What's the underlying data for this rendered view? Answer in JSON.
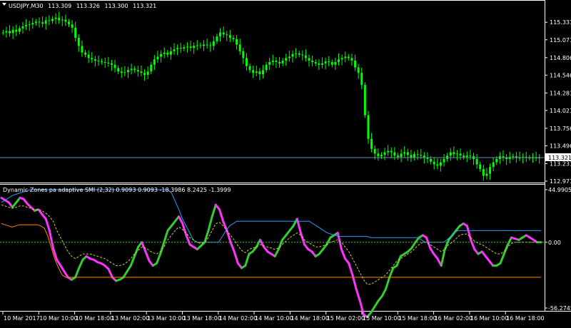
{
  "chart_data": [
    {
      "type": "candlestick",
      "title": "USDJPY,M30",
      "quote": [
        "113.309",
        "113.326",
        "113.300",
        "113.321"
      ],
      "ylim": [
        112.971,
        115.45
      ],
      "ticks": [
        "115.331",
        "115.071",
        "114.806",
        "114.546",
        "114.281",
        "114.021",
        "113.756",
        "113.496",
        "113.231",
        "112.971"
      ],
      "current_price": "113.321",
      "colors": {
        "up": "#00ff00",
        "down": "#00ff00",
        "bg": "#000000",
        "grid": "#ffffff",
        "line": "#6a8fb3",
        "pricebox": "#ffffff"
      },
      "close": [
        115.18,
        115.2,
        115.17,
        115.22,
        115.19,
        115.24,
        115.27,
        115.29,
        115.3,
        115.32,
        115.34,
        115.33,
        115.31,
        115.36,
        115.35,
        115.38,
        115.4,
        115.36,
        115.37,
        115.34,
        115.3,
        115.25,
        115.1,
        114.98,
        114.88,
        114.85,
        114.8,
        114.78,
        114.76,
        114.75,
        114.74,
        114.73,
        114.72,
        114.7,
        114.65,
        114.6,
        114.58,
        114.59,
        114.62,
        114.64,
        114.62,
        114.6,
        114.58,
        114.55,
        114.6,
        114.7,
        114.78,
        114.82,
        114.86,
        114.88,
        114.85,
        114.9,
        114.93,
        114.95,
        114.94,
        114.96,
        114.97,
        114.95,
        114.98,
        114.99,
        114.98,
        115.0,
        114.99,
        114.98,
        115.05,
        115.12,
        115.18,
        115.15,
        115.14,
        115.1,
        115.08,
        115.0,
        114.9,
        114.8,
        114.68,
        114.62,
        114.58,
        114.6,
        114.56,
        114.62,
        114.7,
        114.74,
        114.76,
        114.74,
        114.72,
        114.76,
        114.8,
        114.82,
        114.86,
        114.87,
        114.85,
        114.84,
        114.8,
        114.76,
        114.74,
        114.72,
        114.7,
        114.72,
        114.75,
        114.74,
        114.7,
        114.74,
        114.78,
        114.8,
        114.82,
        114.8,
        114.76,
        114.66,
        114.58,
        114.4,
        113.95,
        113.6,
        113.45,
        113.38,
        113.34,
        113.36,
        113.4,
        113.42,
        113.4,
        113.35,
        113.33,
        113.38,
        113.4,
        113.36,
        113.32,
        113.37,
        113.36,
        113.35,
        113.32,
        113.3,
        113.26,
        113.22,
        113.2,
        113.25,
        113.3,
        113.35,
        113.4,
        113.37,
        113.38,
        113.35,
        113.33,
        113.35,
        113.34,
        113.3,
        113.22,
        113.15,
        113.05,
        113.08,
        113.18,
        113.25,
        113.3,
        113.34,
        113.32,
        113.3,
        113.33,
        113.34,
        113.32,
        113.32,
        113.33,
        113.32,
        113.32,
        113.32,
        113.32,
        113.32
      ]
    },
    {
      "type": "line",
      "title": "Dynamic Zones pa adaptive SMI (2,32) 0.9093 0.9093 -18.3986 8.2425 -1.3999",
      "ylim": [
        -56.2745,
        44.9905
      ],
      "ticks": [
        "44.9905",
        "0.00",
        "-56.2745"
      ],
      "current_value": "0.00",
      "series": [
        {
          "name": "SMI",
          "colors": [
            "#ff33ff",
            "#33cc33"
          ],
          "values": [
            38,
            36,
            34,
            30,
            34,
            38,
            37,
            33,
            30,
            27,
            28,
            24,
            20,
            10,
            -5,
            -15,
            -20,
            -25,
            -30,
            -32,
            -30,
            -22,
            -15,
            -12,
            -14,
            -15,
            -17,
            -18,
            -20,
            -23,
            -30,
            -33,
            -32,
            -30,
            -25,
            -20,
            -12,
            -4,
            0,
            -8,
            -16,
            -20,
            -18,
            -10,
            0,
            10,
            14,
            18,
            22,
            16,
            6,
            -2,
            -4,
            -6,
            -3,
            0,
            10,
            22,
            32,
            28,
            18,
            10,
            0,
            -8,
            -18,
            -22,
            -20,
            -10,
            -8,
            -4,
            2,
            -4,
            -8,
            -10,
            -12,
            -6,
            2,
            6,
            10,
            14,
            20,
            8,
            -2,
            -6,
            -8,
            -12,
            -10,
            -6,
            -2,
            4,
            6,
            8,
            -6,
            -14,
            -18,
            -28,
            -40,
            -50,
            -62,
            -64,
            -60,
            -55,
            -50,
            -46,
            -40,
            -30,
            -22,
            -20,
            -12,
            -10,
            -8,
            -5,
            0,
            4,
            6,
            4,
            -5,
            -10,
            -14,
            -20,
            -6,
            2,
            6,
            10,
            14,
            16,
            14,
            2,
            -6,
            -10,
            -8,
            -12,
            -16,
            -20,
            -20,
            -18,
            -10,
            -2,
            4,
            3,
            2,
            4,
            6,
            4,
            2,
            0,
            0
          ]
        },
        {
          "name": "Upper zone",
          "color": "#3399ff",
          "values": [
            34,
            36,
            38,
            40,
            41,
            42,
            43,
            44,
            45,
            45,
            45,
            45,
            45,
            45,
            45,
            45,
            45,
            45,
            45,
            45,
            45,
            45,
            45,
            45,
            45,
            45,
            45,
            45,
            45,
            45,
            45,
            45,
            45,
            45,
            45,
            45,
            45,
            45,
            45,
            45,
            45,
            45,
            45,
            45,
            45,
            45,
            45,
            42,
            35,
            28,
            20,
            14,
            8,
            2,
            0,
            0,
            0,
            0,
            0,
            0,
            0,
            5,
            10,
            14,
            16,
            18,
            18,
            18,
            18,
            18,
            18,
            18,
            18,
            18,
            18,
            18,
            18,
            18,
            18,
            18,
            18,
            18,
            18,
            18,
            18,
            18,
            16,
            14,
            12,
            10,
            8,
            7,
            6,
            5,
            5,
            5,
            5,
            5,
            5,
            5,
            5,
            5,
            4,
            4,
            4,
            4,
            4,
            4,
            4,
            4,
            4,
            4,
            4,
            4,
            4,
            4,
            2,
            0,
            0,
            0,
            0,
            0,
            0,
            2,
            5,
            8,
            10,
            10,
            10,
            10,
            10,
            10,
            10,
            10,
            10,
            10,
            10,
            10,
            10,
            10,
            10,
            10,
            10,
            10,
            10,
            10,
            10,
            10,
            10,
            10
          ]
        },
        {
          "name": "Lower zone",
          "color": "#ff8800",
          "values": [
            16,
            15,
            14,
            13,
            14,
            15,
            15,
            15,
            15,
            15,
            15,
            14,
            12,
            5,
            -5,
            -15,
            -22,
            -28,
            -30,
            -30,
            -30,
            -30,
            -30,
            -30,
            -30,
            -30,
            -30,
            -30,
            -30,
            -30,
            -30,
            -30,
            -30,
            -30,
            -30,
            -30,
            -30,
            -30,
            -30,
            -30,
            -30,
            -30,
            -30,
            -30,
            -30,
            -30,
            -30,
            -30,
            -30,
            -30,
            -30,
            -30,
            -30,
            -30,
            -30,
            -30,
            -30,
            -30,
            -30,
            -30,
            -30,
            -30,
            -30,
            -30,
            -30,
            -30,
            -30,
            -30,
            -30,
            -30,
            -30,
            -30,
            -30,
            -30,
            -30,
            -30,
            -30,
            -30,
            -30,
            -30,
            -30,
            -30,
            -30,
            -30,
            -30,
            -30,
            -30,
            -30,
            -30,
            -30,
            -30,
            -30,
            -30,
            -30,
            -30,
            -30,
            -30,
            -30,
            -30,
            -30,
            -30,
            -30,
            -30,
            -30,
            -30,
            -30,
            -30,
            -30,
            -30,
            -30,
            -30,
            -30,
            -30,
            -30,
            -30,
            -30,
            -30,
            -30,
            -30,
            -30,
            -30,
            -30,
            -30,
            -30,
            -30,
            -30,
            -30,
            -30,
            -30,
            -30,
            -30,
            -30,
            -30,
            -30,
            -30,
            -30,
            -30,
            -30,
            -30,
            -30,
            -30,
            -30,
            -30,
            -30,
            -30,
            -30,
            -30,
            -30,
            -30,
            -30,
            -30,
            -30
          ]
        },
        {
          "name": "Signal",
          "color": "#cccc33",
          "dashed": true,
          "values": [
            32,
            31,
            30,
            29,
            30,
            31,
            31,
            30,
            29,
            28,
            28,
            27,
            25,
            22,
            18,
            10,
            4,
            -2,
            -8,
            -12,
            -14,
            -12,
            -10,
            -10,
            -10,
            -11,
            -12,
            -13,
            -14,
            -16,
            -18,
            -20,
            -20,
            -19,
            -17,
            -14,
            -10,
            -7,
            -4,
            -5,
            -7,
            -9,
            -10,
            -8,
            -4,
            2,
            6,
            10,
            13,
            11,
            8,
            4,
            2,
            0,
            -1,
            0,
            4,
            10,
            16,
            17,
            14,
            10,
            6,
            2,
            -3,
            -7,
            -9,
            -6,
            -5,
            -4,
            -2,
            -3,
            -4,
            -5,
            -6,
            -5,
            -2,
            1,
            4,
            6,
            8,
            6,
            2,
            0,
            -2,
            -4,
            -4,
            -3,
            -2,
            0,
            1,
            2,
            0,
            -4,
            -8,
            -14,
            -20,
            -26,
            -32,
            -36,
            -36,
            -34,
            -32,
            -30,
            -28,
            -24,
            -20,
            -16,
            -14,
            -12,
            -10,
            -8,
            -5,
            -2,
            0,
            0,
            -2,
            -4,
            -6,
            -8,
            -6,
            -2,
            0,
            3,
            6,
            7,
            7,
            4,
            1,
            -1,
            -2,
            -4,
            -6,
            -8,
            -10,
            -10,
            -8,
            -4,
            -1,
            0,
            0,
            0,
            0,
            0,
            0,
            0,
            0
          ]
        },
        {
          "name": "Zero",
          "color": "#33cc33",
          "dashed": true,
          "values": [
            0
          ]
        }
      ]
    }
  ],
  "time_axis": [
    "10 Mar 2017",
    "10 Mar 10:00",
    "10 Mar 18:00",
    "13 Mar 02:00",
    "13 Mar 10:00",
    "13 Mar 18:00",
    "14 Mar 02:00",
    "14 Mar 10:00",
    "14 Mar 18:00",
    "15 Mar 02:00",
    "15 Mar 10:00",
    "15 Mar 18:00",
    "16 Mar 02:00",
    "16 Mar 10:00",
    "16 Mar 18:00"
  ]
}
